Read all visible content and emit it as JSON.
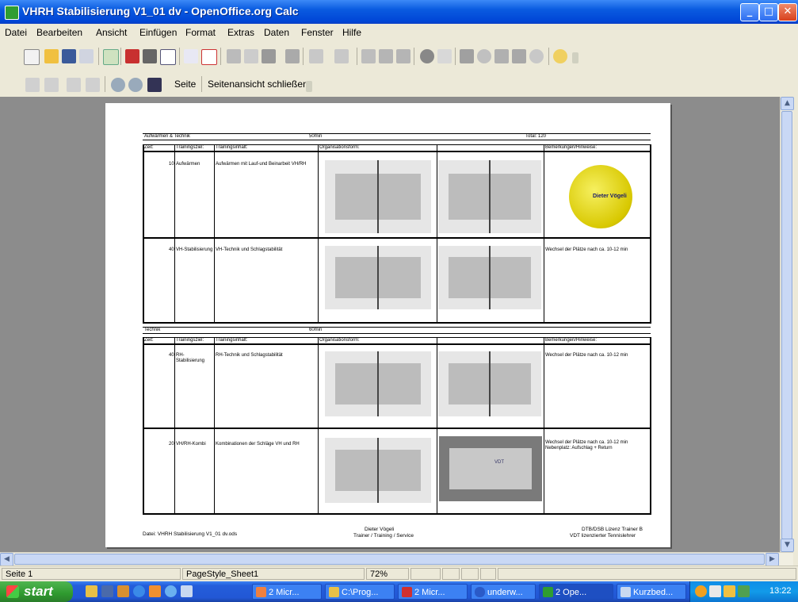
{
  "window": {
    "title": "VHRH Stabilisierung V1_01 dv - OpenOffice.org Calc",
    "buttons": {
      "minimize": "_",
      "maximize": "□",
      "close": "✕"
    }
  },
  "menu": [
    "Datei",
    "Bearbeiten",
    "Ansicht",
    "Einfügen",
    "Format",
    "Extras",
    "Daten",
    "Fenster",
    "Hilfe"
  ],
  "preview_toolbar": {
    "page_label": "Seite",
    "close_preview_label": "Seitenansicht schließen"
  },
  "document": {
    "section1": {
      "title": "Aufwärmen & Technik",
      "duration": "50min",
      "total": "Total: 120"
    },
    "section2": {
      "title": "Technik",
      "duration": "60min"
    },
    "headers": {
      "time": "Zeit:",
      "goal": "Trainingsziel:",
      "content": "Trainingsinhalt:",
      "organisation": "Organisationsform:",
      "remarks": "Bemerkungen/Hinweise:"
    },
    "rows1": [
      {
        "time": "10",
        "goal": "Aufwärmen",
        "content": "Aufwärmen mit Lauf-und Beinarbeit VH/RH",
        "remarks": ""
      },
      {
        "time": "40",
        "goal": "VH-Stabilisierung",
        "content": "VH-Technik und Schlagstabilität",
        "remarks": "Wechsel der Plätze nach ca. 10-12 min"
      }
    ],
    "rows2": [
      {
        "time": "40",
        "goal": "RH-Stabilisierung",
        "content": "RH-Technik und Schlagstabilität",
        "remarks": "Wechsel der Plätze nach ca. 10-12 min"
      },
      {
        "time": "20",
        "goal": "VH/RH-Kombi",
        "content": "Kombinationen der Schläge VH und RH",
        "remarks": "Wechsel der Plätze nach ca. 10-12 min Nebenplatz: Aufschlag + Return"
      }
    ],
    "logo_text": "Dieter Vögeli",
    "footer": {
      "left": "Datei: VHRH Stabilisierung V1_01 dv.ods",
      "center_line1": "Dieter Vögeli",
      "center_line2": "Trainer / Training / Service",
      "right_line1": "DTB/DSB Lizenz Trainer B",
      "right_line2": "VDT lizenzierter Tennislehrer"
    },
    "court_label": "VDT"
  },
  "status": {
    "page": "Seite 1",
    "style": "PageStyle_Sheet1",
    "zoom": "72%"
  },
  "taskbar": {
    "start": "start",
    "buttons": [
      "2 Micr...",
      "C:\\Prog...",
      "2 Micr...",
      "underw...",
      "2 Ope...",
      "Kurzbed..."
    ],
    "clock": "13:22"
  }
}
